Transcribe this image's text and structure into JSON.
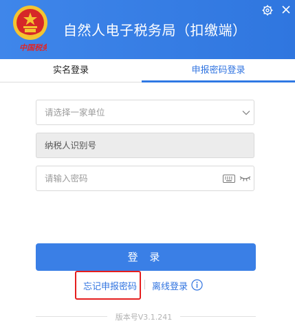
{
  "header": {
    "title": "自然人电子税务局（扣缴端）",
    "brand_text": "中国税务",
    "emblem_icon": "national-emblem-icon",
    "settings_icon": "gear-icon",
    "close_icon": "close-icon",
    "bg_color": "#3a80e8"
  },
  "tabs": [
    {
      "label": "实名登录",
      "active": false
    },
    {
      "label": "申报密码登录",
      "active": true
    }
  ],
  "form": {
    "unit_placeholder": "请选择一家单位",
    "taxid_value": "纳税人识别号",
    "password_placeholder": "请输入密码",
    "keyboard_icon": "keyboard-icon",
    "eye_icon": "eye-closed-icon",
    "dropdown_icon": "chevron-down-icon"
  },
  "actions": {
    "login_label": "登 录",
    "forgot_label": "忘记申报密码",
    "offline_label": "离线登录",
    "info_icon": "info-icon"
  },
  "footer": {
    "version": "版本号V3.1.241"
  },
  "colors": {
    "accent": "#2f73e0",
    "button": "#3a7fe6",
    "highlight": "#e51d1d"
  }
}
